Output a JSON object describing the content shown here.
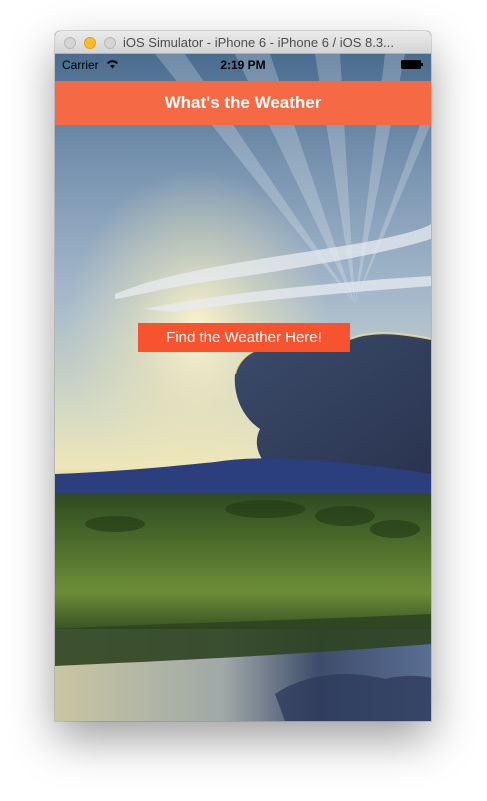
{
  "window": {
    "title": "iOS Simulator - iPhone 6 - iPhone 6 / iOS 8.3..."
  },
  "status_bar": {
    "carrier": "Carrier",
    "time": "2:19 PM"
  },
  "nav": {
    "title": "What's the Weather"
  },
  "main": {
    "button_label": "Find the Weather Here!"
  },
  "icons": {
    "wifi": "wifi-icon",
    "battery": "battery-icon",
    "window_controls": [
      "close-button",
      "minimize-button",
      "zoom-button"
    ]
  },
  "colors": {
    "nav_bar": "#f56a45",
    "button": "#f7532e",
    "nav_text": "#ffffff"
  }
}
